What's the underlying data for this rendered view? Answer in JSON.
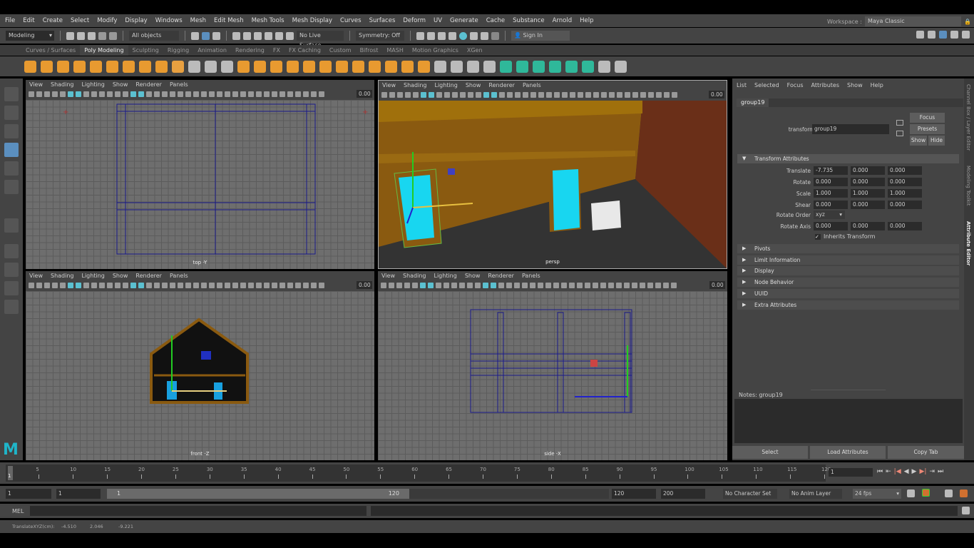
{
  "menubar": [
    "File",
    "Edit",
    "Create",
    "Select",
    "Modify",
    "Display",
    "Windows",
    "Mesh",
    "Edit Mesh",
    "Mesh Tools",
    "Mesh Display",
    "Curves",
    "Surfaces",
    "Deform",
    "UV",
    "Generate",
    "Cache",
    "Substance",
    "Arnold",
    "Help"
  ],
  "status": {
    "mode": "Modeling",
    "selection": "All objects",
    "live_surface": "No Live Surface",
    "symmetry": "Symmetry: Off",
    "sign_in": "Sign In",
    "workspace_label": "Workspace :",
    "workspace": "Maya Classic"
  },
  "shelf_tabs": [
    "Curves / Surfaces",
    "Poly Modeling",
    "Sculpting",
    "Rigging",
    "Animation",
    "Rendering",
    "FX",
    "FX Caching",
    "Custom",
    "Bifrost",
    "MASH",
    "Motion Graphics",
    "XGen"
  ],
  "shelf_active": "Poly Modeling",
  "viewport_menu": [
    "View",
    "Shading",
    "Lighting",
    "Show",
    "Renderer",
    "Panels"
  ],
  "viewports": [
    {
      "camera": "top -Y",
      "value": "0.00"
    },
    {
      "camera": "persp",
      "value": "0.00"
    },
    {
      "camera": "front -Z",
      "value": "0.00"
    },
    {
      "camera": "side -X",
      "value": "0.00"
    }
  ],
  "attribute_editor": {
    "menu": [
      "List",
      "Selected",
      "Focus",
      "Attributes",
      "Show",
      "Help"
    ],
    "tab": "group19",
    "transform_label": "transform:",
    "transform_value": "group19",
    "buttons": {
      "focus": "Focus",
      "presets": "Presets",
      "show": "Show",
      "hide": "Hide"
    },
    "section": "Transform Attributes",
    "rows": [
      {
        "label": "Translate",
        "values": [
          "-7.735",
          "0.000",
          "0.000"
        ]
      },
      {
        "label": "Rotate",
        "values": [
          "0.000",
          "0.000",
          "0.000"
        ]
      },
      {
        "label": "Scale",
        "values": [
          "1.000",
          "1.000",
          "1.000"
        ]
      },
      {
        "label": "Shear",
        "values": [
          "0.000",
          "0.000",
          "0.000"
        ]
      }
    ],
    "rotate_order_label": "Rotate Order",
    "rotate_order": "xyz",
    "rotate_axis": {
      "label": "Rotate Axis",
      "values": [
        "0.000",
        "0.000",
        "0.000"
      ]
    },
    "inherits": "Inherits Transform",
    "inherits_checked": true,
    "collapsed_sections": [
      "Pivots",
      "Limit Information",
      "Display",
      "Node Behavior",
      "UUID",
      "Extra Attributes"
    ],
    "notes": "Notes:  group19",
    "bottom_buttons": [
      "Select",
      "Load Attributes",
      "Copy Tab"
    ],
    "side_tabs": [
      "Channel Box / Layer Editor",
      "Modeling Toolkit",
      "Attribute Editor"
    ]
  },
  "timeline": {
    "ticks": [
      "5",
      "10",
      "15",
      "20",
      "25",
      "30",
      "35",
      "40",
      "45",
      "50",
      "55",
      "60",
      "65",
      "70",
      "75",
      "80",
      "85",
      "90",
      "95",
      "100",
      "105",
      "110",
      "115",
      "120"
    ],
    "current": "1",
    "current_field": "1"
  },
  "range": {
    "start": "1",
    "playback_start": "1",
    "slider_start": "1",
    "slider_end": "120",
    "playback_end": "120",
    "end": "200",
    "character_set": "No Character Set",
    "anim_layer": "No Anim Layer",
    "fps": "24 fps"
  },
  "mel": {
    "label": "MEL"
  },
  "help_line": {
    "label": "TranslateXYZ(cm):",
    "x": "-4.510",
    "y": "2.046",
    "z": "-9.221"
  }
}
